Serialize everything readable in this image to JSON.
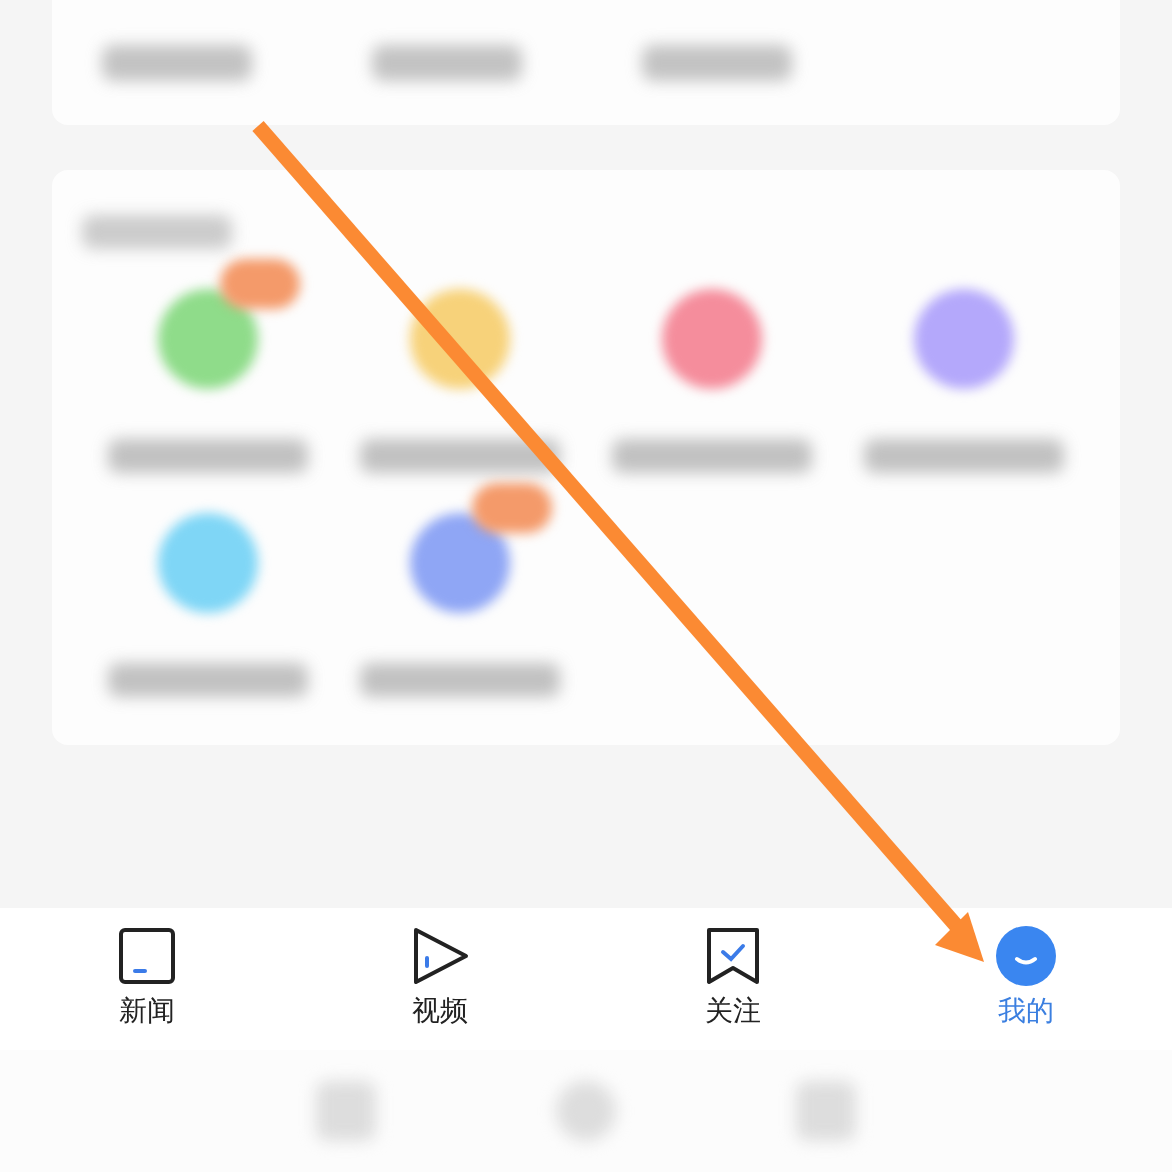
{
  "apps": [
    {
      "color": "#8fdc8a",
      "badge": true
    },
    {
      "color": "#f7d27a",
      "badge": false
    },
    {
      "color": "#f58d9c",
      "badge": false
    },
    {
      "color": "#b4a8fb",
      "badge": false
    },
    {
      "color": "#7fd6f6",
      "badge": false
    },
    {
      "color": "#8fa6f5",
      "badge": true
    }
  ],
  "tabs": [
    {
      "kind": "news",
      "label": "新闻",
      "selected": false
    },
    {
      "kind": "video",
      "label": "视频",
      "selected": false
    },
    {
      "kind": "follow",
      "label": "关注",
      "selected": false
    },
    {
      "kind": "profile",
      "label": "我的",
      "selected": true
    }
  ]
}
